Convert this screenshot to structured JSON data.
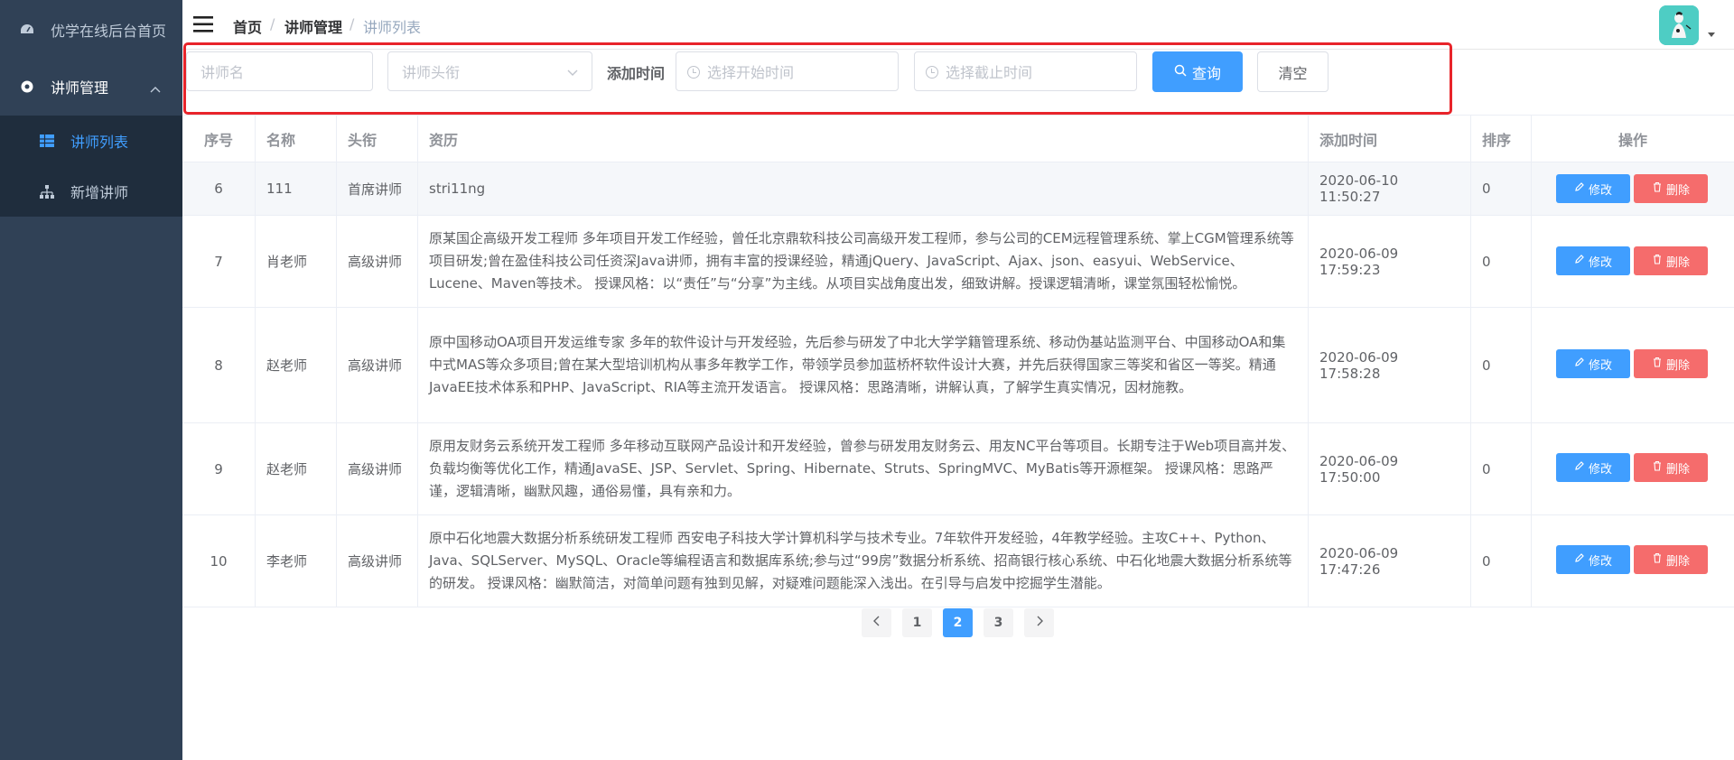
{
  "sidebar": {
    "items": [
      {
        "label": "优学在线后台首页",
        "icon": "dashboard-icon"
      },
      {
        "label": "讲师管理",
        "icon": "gear-icon"
      },
      {
        "label": "讲师列表",
        "icon": "table-icon"
      },
      {
        "label": "新增讲师",
        "icon": "tree-icon"
      }
    ]
  },
  "navbar": {
    "breadcrumb": [
      "首页",
      "讲师管理",
      "讲师列表"
    ],
    "separator": "/"
  },
  "filter": {
    "name_placeholder": "讲师名",
    "level_placeholder": "讲师头衔",
    "time_label": "添加时间",
    "begin_placeholder": "选择开始时间",
    "end_placeholder": "选择截止时间",
    "query_label": "查询",
    "clear_label": "清空"
  },
  "table": {
    "headers": [
      "序号",
      "名称",
      "头衔",
      "资历",
      "添加时间",
      "排序",
      "操作"
    ],
    "edit_label": "修改",
    "delete_label": "删除",
    "rows": [
      {
        "no": "6",
        "name": "111",
        "level": "首席讲师",
        "intro": "stri11ng",
        "time": "2020-06-10 11:50:27",
        "sort": "0"
      },
      {
        "no": "7",
        "name": "肖老师",
        "level": "高级讲师",
        "intro": "原某国企高级开发工程师 多年项目开发工作经验，曾任北京鼎软科技公司高级开发工程师，参与公司的CEM远程管理系统、掌上CGM管理系统等项目研发;曾在盈佳科技公司任资深Java讲师，拥有丰富的授课经验，精通jQuery、JavaScript、Ajax、json、easyui、WebService、Lucene、Maven等技术。 授课风格：以“责任”与“分享”为主线。从项目实战角度出发，细致讲解。授课逻辑清晰，课堂氛围轻松愉悦。",
        "time": "2020-06-09 17:59:23",
        "sort": "0"
      },
      {
        "no": "8",
        "name": "赵老师",
        "level": "高级讲师",
        "intro": "原中国移动OA项目开发运维专家 多年的软件设计与开发经验，先后参与研发了中北大学学籍管理系统、移动伪基站监测平台、中国移动OA和集中式MAS等众多项目;曾在某大型培训机构从事多年教学工作，带领学员参加蓝桥杯软件设计大赛，并先后获得国家三等奖和省区一等奖。精通JavaEE技术体系和PHP、JavaScript、RIA等主流开发语言。 授课风格：思路清晰，讲解认真，了解学生真实情况，因材施教。",
        "time": "2020-06-09 17:58:28",
        "sort": "0"
      },
      {
        "no": "9",
        "name": "赵老师",
        "level": "高级讲师",
        "intro": "原用友财务云系统开发工程师 多年移动互联网产品设计和开发经验，曾参与研发用友财务云、用友NC平台等项目。长期专注于Web项目高并发、负载均衡等优化工作，精通JavaSE、JSP、Servlet、Spring、Hibernate、Struts、SpringMVC、MyBatis等开源框架。 授课风格：思路严谨，逻辑清晰，幽默风趣，通俗易懂，具有亲和力。",
        "time": "2020-06-09 17:50:00",
        "sort": "0"
      },
      {
        "no": "10",
        "name": "李老师",
        "level": "高级讲师",
        "intro": "原中石化地震大数据分析系统研发工程师 西安电子科技大学计算机科学与技术专业。7年软件开发经验，4年教学经验。主攻C++、Python、Java、SQLServer、MySQL、Oracle等编程语言和数据库系统;参与过“99房”数据分析系统、招商银行核心系统、中石化地震大数据分析系统等的研发。 授课风格：幽默简洁，对简单问题有独到见解，对疑难问题能深入浅出。在引导与启发中挖掘学生潜能。",
        "time": "2020-06-09 17:47:26",
        "sort": "0"
      }
    ]
  },
  "pagination": {
    "pages": [
      "1",
      "2",
      "3"
    ],
    "current": "2"
  },
  "colors": {
    "primary": "#409eff",
    "danger": "#f56c6c",
    "sidebar": "#304156",
    "highlight": "#e8242a"
  }
}
